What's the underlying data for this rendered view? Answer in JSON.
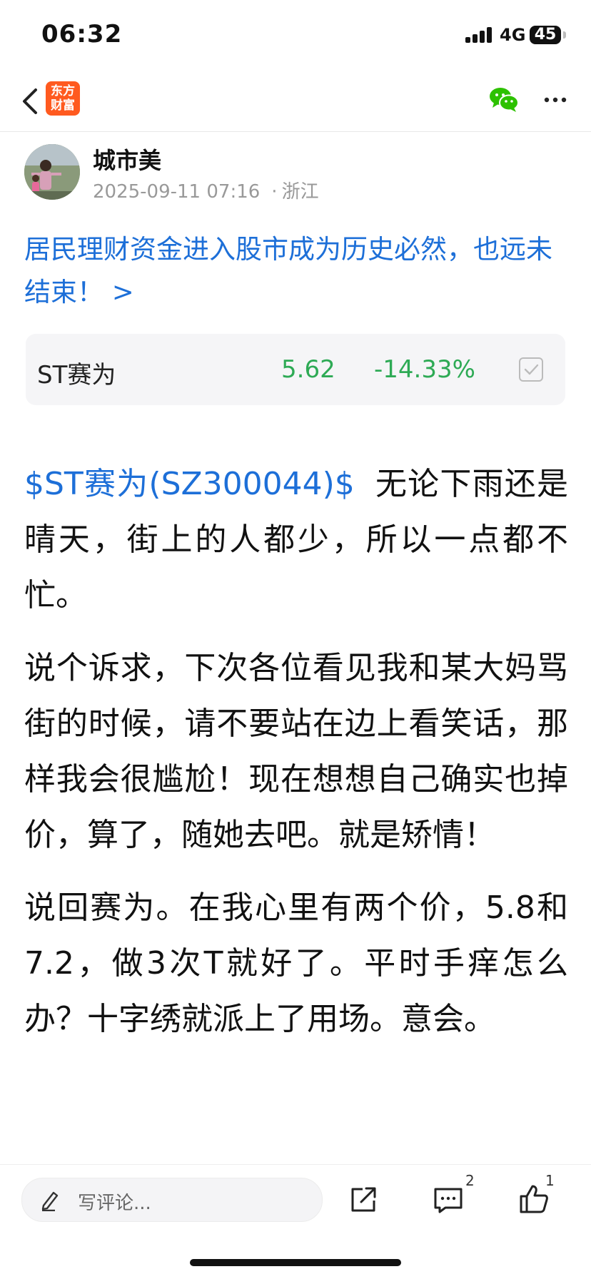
{
  "status_bar": {
    "time": "06:32",
    "network": "4G",
    "battery": "45"
  },
  "nav": {
    "logo_text": "东方财富"
  },
  "author": {
    "name": "城市美",
    "datetime": "2025-09-11 07:16",
    "location": "浙江"
  },
  "article": {
    "title_link": "居民理财资金进入股市成为历史必然，也远未结束！ >"
  },
  "stock": {
    "name": "ST赛为",
    "price": "5.62",
    "change": "-14.33%",
    "color": "#2eaa55"
  },
  "post": {
    "ticker": "$ST赛为(SZ300044)$",
    "p1": "无论下雨还是晴天，街上的人都少，所以一点都不忙。",
    "p2": "说个诉求，下次各位看见我和某大妈骂街的时候，请不要站在边上看笑话，那样我会很尴尬！现在想想自己确实也掉价，算了，随她去吧。就是矫情！",
    "p3": "说回赛为。在我心里有两个价，5.8和7.2，做3次T就好了。平时手痒怎么办？十字绣就派上了用场。意会。"
  },
  "bottom_bar": {
    "comment_placeholder": "写评论...",
    "comment_count": "2",
    "like_count": "1"
  },
  "colors": {
    "link": "#1d6fd8",
    "brand": "#ff5a1f",
    "down": "#2eaa55"
  },
  "icons": [
    "back-arrow-icon",
    "wechat-icon",
    "more-icon",
    "pen-icon",
    "share-icon",
    "comment-icon",
    "like-icon",
    "checkbox-icon"
  ]
}
